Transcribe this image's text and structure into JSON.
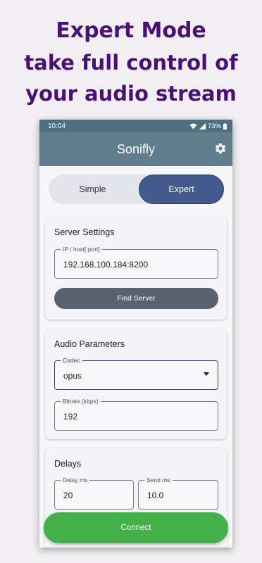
{
  "promo": {
    "line1": "Expert Mode",
    "line2": "take full control of",
    "line3": "your audio stream"
  },
  "status_bar": {
    "time": "10:04",
    "battery": "73%"
  },
  "app_bar": {
    "title": "Sonifly",
    "settings_icon": "gear-icon"
  },
  "mode_toggle": {
    "simple_label": "Simple",
    "expert_label": "Expert",
    "selected": "Expert"
  },
  "server_settings": {
    "title": "Server Settings",
    "host_label": "IP / host[:port]",
    "host_value": "192.168.100.184:8200",
    "find_button": "Find Server"
  },
  "audio_parameters": {
    "title": "Audio Parameters",
    "codec_label": "Codec",
    "codec_value": "opus",
    "bitrate_label": "Bitrate (kbps)",
    "bitrate_value": "192"
  },
  "delays": {
    "title": "Delays",
    "delay_label": "Delay ms",
    "delay_value": "20",
    "send_label": "Send ms",
    "send_value": "10.0"
  },
  "connect_button": "Connect",
  "colors": {
    "headline": "#4b0f78",
    "app_bar": "#5f7d8a",
    "toggle_selected": "#435a8d",
    "connect": "#43b04a"
  }
}
